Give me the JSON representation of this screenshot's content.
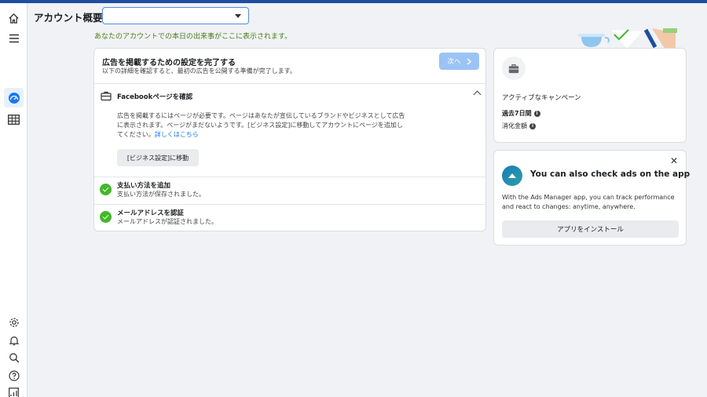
{
  "header": {
    "title": "アカウント概要",
    "account_select_value": ""
  },
  "banner": {
    "text": "あなたのアカウントでの本日の出来事がここに表示されます。"
  },
  "setup": {
    "title": "広告を掲載するための設定を完了する",
    "subtitle": "以下の詳細を確認すると、最初の広告を公開する準備が完了します。",
    "next_label": "次へ",
    "facebook_page": {
      "title": "Facebookページを確認",
      "body_line1": "広告を掲載するにはページが必要です。ページはあなたが宣伝しているブランドやビジネスとして広告",
      "body_line2": "に表示されます。ページがまだないようです。[ビジネス設定]に移動してアカウントにページを追加し",
      "body_line3": "てください。",
      "link": "詳しくはこちら",
      "button_label": "[ビジネス設定]に移動"
    },
    "payment": {
      "title": "支払い方法を追加",
      "subtitle": "支払い方法が保存されました。"
    },
    "email": {
      "title": "メールアドレスを認証",
      "subtitle": "メールアドレスが認証されました。"
    }
  },
  "campaigns": {
    "title": "アクティブなキャンペーン",
    "period_label": "過去7日間",
    "spend_label": "消化金額"
  },
  "app_promo": {
    "title": "You can also check ads on the app",
    "description": "With the Ads Manager app, you can track performance and react to changes: anytime, anywhere.",
    "install_label": "アプリをインストール"
  },
  "icons": {
    "home": "home-icon",
    "menu": "menu-icon",
    "overview": "gauge-icon",
    "table": "table-icon",
    "settings": "gear-icon",
    "notifications": "bell-icon",
    "search": "search-icon",
    "help": "help-icon",
    "reports": "report-icon"
  },
  "colors": {
    "accent": "#1877f2",
    "topbar": "#1d4ea0",
    "success": "#42b72a",
    "banner_text": "#4b7a1a"
  }
}
